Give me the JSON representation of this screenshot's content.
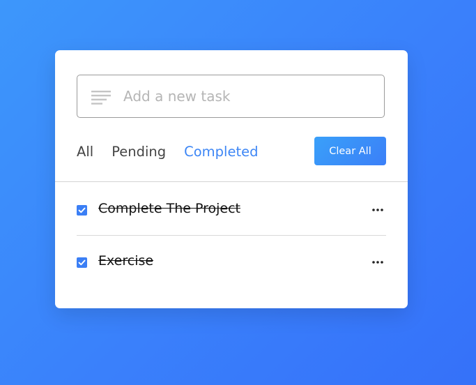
{
  "input": {
    "value": "",
    "placeholder": "Add a new task",
    "icon": "lines-icon"
  },
  "filters": {
    "all": "All",
    "pending": "Pending",
    "completed": "Completed",
    "active": "Completed"
  },
  "clear_button": "Clear All",
  "tasks": [
    {
      "label": "Complete The Project",
      "checked": true
    },
    {
      "label": "Exercise",
      "checked": true
    }
  ],
  "colors": {
    "accent": "#3d86f5",
    "background_gradient_start": "#3d97fb",
    "background_gradient_end": "#3571f9"
  }
}
